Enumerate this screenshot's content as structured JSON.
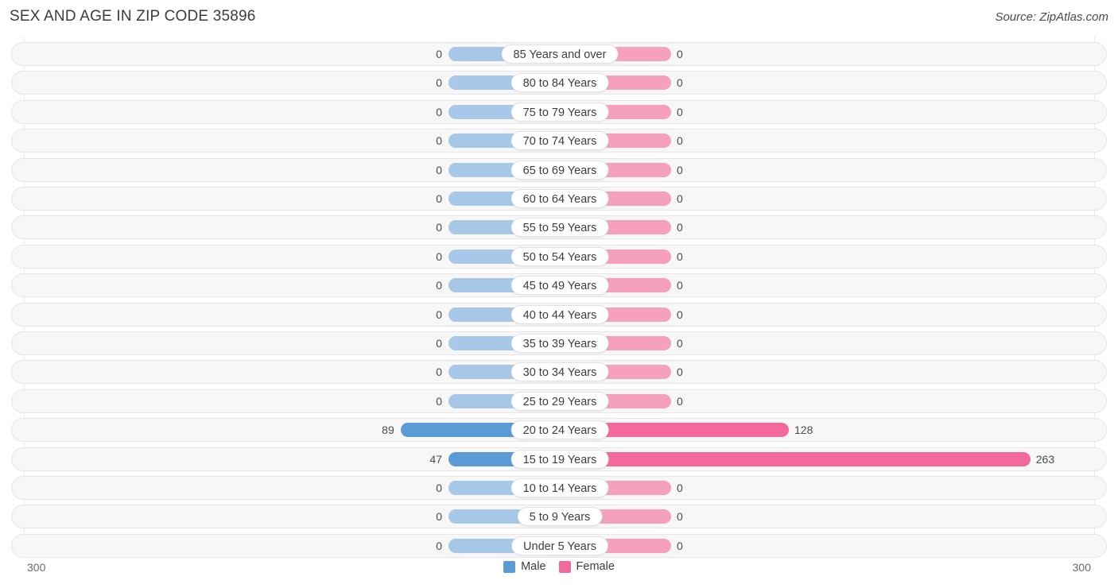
{
  "header": {
    "title": "SEX AND AGE IN ZIP CODE 35896",
    "source": "Source: ZipAtlas.com"
  },
  "legend": {
    "male_label": "Male",
    "female_label": "Female",
    "male_color": "#5b9bd5",
    "female_color": "#f4699b"
  },
  "axis": {
    "left_label": "300",
    "right_label": "300",
    "max": 300
  },
  "colors": {
    "male_active": "#5b9bd5",
    "male_zero": "#a8c8e8",
    "female_active": "#f4699b",
    "female_zero": "#f5a0bd",
    "row_bg": "#f7f7f8",
    "row_border": "#e6e6e8",
    "pill_bg": "#ffffff",
    "text": "#4b4b4b"
  },
  "chart_data": {
    "type": "bar",
    "title": "SEX AND AGE IN ZIP CODE 35896",
    "subtitle": "Source: ZipAtlas.com",
    "orientation": "horizontal-diverging",
    "xlabel": "",
    "ylabel": "",
    "xlim": [
      300,
      300
    ],
    "grid": true,
    "legend_position": "bottom-center",
    "categories": [
      "85 Years and over",
      "80 to 84 Years",
      "75 to 79 Years",
      "70 to 74 Years",
      "65 to 69 Years",
      "60 to 64 Years",
      "55 to 59 Years",
      "50 to 54 Years",
      "45 to 49 Years",
      "40 to 44 Years",
      "35 to 39 Years",
      "30 to 34 Years",
      "25 to 29 Years",
      "20 to 24 Years",
      "15 to 19 Years",
      "10 to 14 Years",
      "5 to 9 Years",
      "Under 5 Years"
    ],
    "series": [
      {
        "name": "Male",
        "color": "#5b9bd5",
        "values": [
          0,
          0,
          0,
          0,
          0,
          0,
          0,
          0,
          0,
          0,
          0,
          0,
          0,
          89,
          47,
          0,
          0,
          0
        ]
      },
      {
        "name": "Female",
        "color": "#f4699b",
        "values": [
          0,
          0,
          0,
          0,
          0,
          0,
          0,
          0,
          0,
          0,
          0,
          0,
          0,
          128,
          263,
          0,
          0,
          0
        ]
      }
    ]
  },
  "rows": [
    {
      "label": "85 Years and over",
      "male": "0",
      "female": "0",
      "male_value": 0,
      "female_value": 0
    },
    {
      "label": "80 to 84 Years",
      "male": "0",
      "female": "0",
      "male_value": 0,
      "female_value": 0
    },
    {
      "label": "75 to 79 Years",
      "male": "0",
      "female": "0",
      "male_value": 0,
      "female_value": 0
    },
    {
      "label": "70 to 74 Years",
      "male": "0",
      "female": "0",
      "male_value": 0,
      "female_value": 0
    },
    {
      "label": "65 to 69 Years",
      "male": "0",
      "female": "0",
      "male_value": 0,
      "female_value": 0
    },
    {
      "label": "60 to 64 Years",
      "male": "0",
      "female": "0",
      "male_value": 0,
      "female_value": 0
    },
    {
      "label": "55 to 59 Years",
      "male": "0",
      "female": "0",
      "male_value": 0,
      "female_value": 0
    },
    {
      "label": "50 to 54 Years",
      "male": "0",
      "female": "0",
      "male_value": 0,
      "female_value": 0
    },
    {
      "label": "45 to 49 Years",
      "male": "0",
      "female": "0",
      "male_value": 0,
      "female_value": 0
    },
    {
      "label": "40 to 44 Years",
      "male": "0",
      "female": "0",
      "male_value": 0,
      "female_value": 0
    },
    {
      "label": "35 to 39 Years",
      "male": "0",
      "female": "0",
      "male_value": 0,
      "female_value": 0
    },
    {
      "label": "30 to 34 Years",
      "male": "0",
      "female": "0",
      "male_value": 0,
      "female_value": 0
    },
    {
      "label": "25 to 29 Years",
      "male": "0",
      "female": "0",
      "male_value": 0,
      "female_value": 0
    },
    {
      "label": "20 to 24 Years",
      "male": "89",
      "female": "128",
      "male_value": 89,
      "female_value": 128
    },
    {
      "label": "15 to 19 Years",
      "male": "47",
      "female": "263",
      "male_value": 47,
      "female_value": 263
    },
    {
      "label": "10 to 14 Years",
      "male": "0",
      "female": "0",
      "male_value": 0,
      "female_value": 0
    },
    {
      "label": "5 to 9 Years",
      "male": "0",
      "female": "0",
      "male_value": 0,
      "female_value": 0
    },
    {
      "label": "Under 5 Years",
      "male": "0",
      "female": "0",
      "male_value": 0,
      "female_value": 0
    }
  ]
}
